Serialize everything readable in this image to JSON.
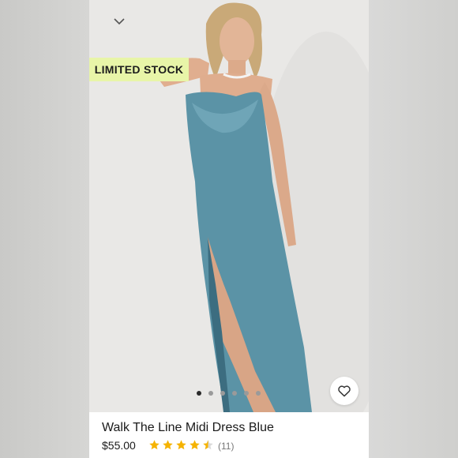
{
  "badge": {
    "label": "LIMITED STOCK"
  },
  "product": {
    "title": "Walk The Line Midi Dress Blue",
    "price": "$55.00",
    "rating": 4.5,
    "review_count": "(11)"
  },
  "carousel": {
    "total": 6,
    "active": 0
  },
  "icons": {
    "collapse": "chevron-down-icon",
    "favorite": "heart-icon",
    "rating": "star-icon"
  },
  "colors": {
    "badge_bg": "#e8f5a8",
    "star": "#f5b301",
    "dress": "#5b93a6"
  }
}
